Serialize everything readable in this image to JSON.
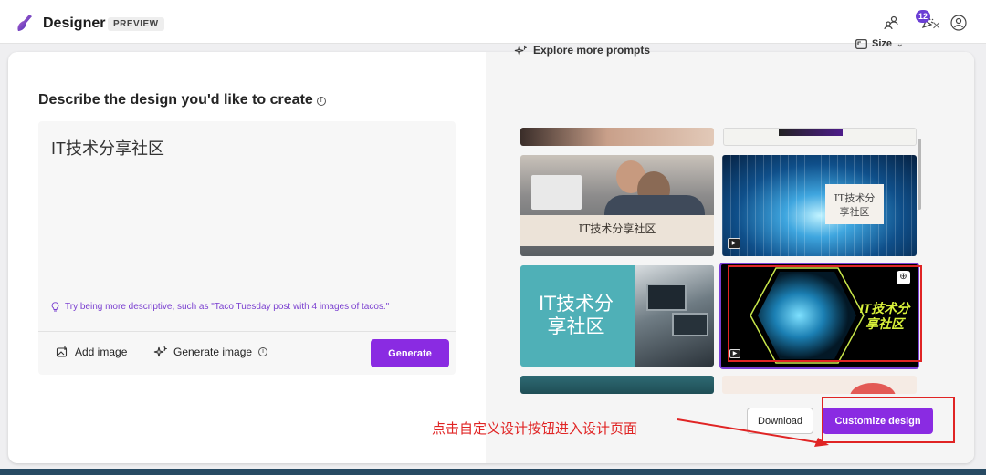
{
  "header": {
    "app_title": "Designer",
    "badge": "PREVIEW",
    "notification_count": "12"
  },
  "left": {
    "heading": "Describe the design you'd like to create",
    "prompt_value": "IT技术分享社区",
    "tip": "Try being more descriptive, such as \"Taco Tuesday post with 4 images of tacos.\"",
    "add_image": "Add image",
    "generate_image": "Generate image",
    "generate_button": "Generate"
  },
  "right": {
    "explore": "Explore more prompts",
    "size": "Size",
    "close": "×",
    "designs": [
      {
        "text": "IT技术分享社区"
      },
      {
        "text": "IT技术分\n享社区"
      },
      {
        "text": "IT技术分\n享社区"
      },
      {
        "text": "IT技术分\n享社区"
      }
    ],
    "download_button": "Download",
    "customize_button": "Customize design"
  },
  "annotation": {
    "text": "点击自定义设计按钮进入设计页面"
  },
  "colors": {
    "accent": "#8a2be2",
    "annotation": "#e02424",
    "selected_border": "#7b3fd6"
  }
}
